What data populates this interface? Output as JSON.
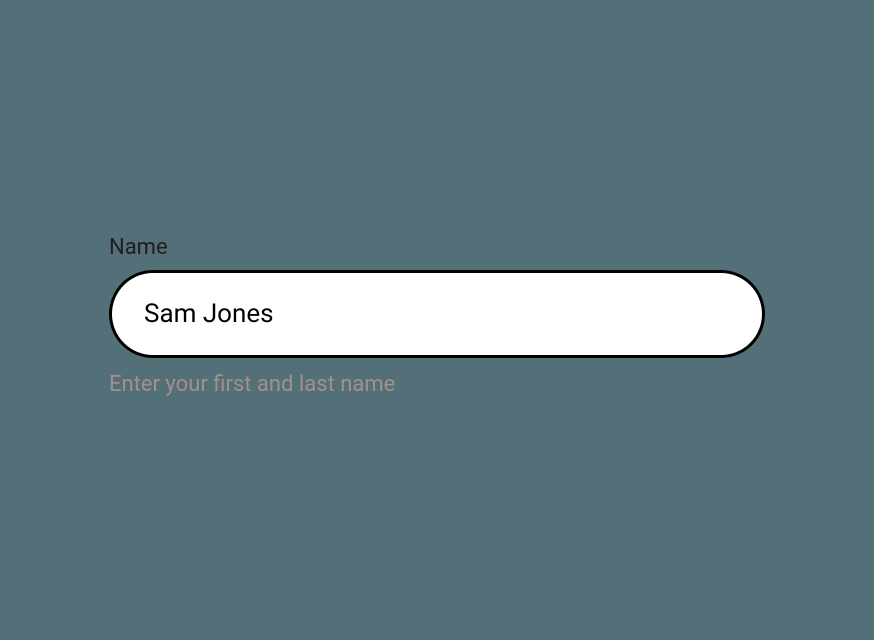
{
  "form": {
    "name_field": {
      "label": "Name",
      "value": "Sam Jones",
      "helper": "Enter your first and last name"
    }
  }
}
